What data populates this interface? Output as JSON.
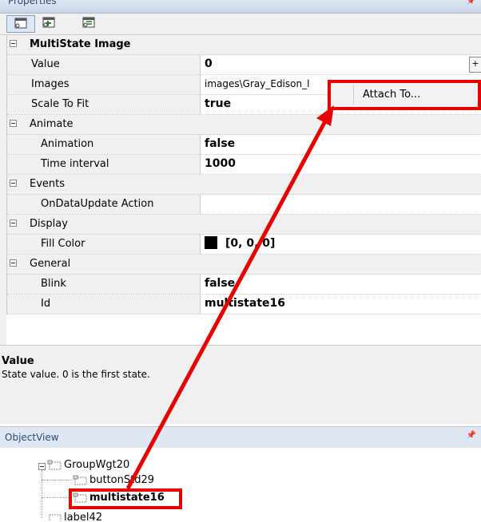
{
  "panel": {
    "title": "Properties"
  },
  "toolbar": {
    "buttons": [
      {
        "icon": "categorized-view-icon"
      },
      {
        "icon": "alphabetical-view-icon"
      },
      {
        "icon": "events-view-icon"
      }
    ]
  },
  "grid": {
    "category_main": "MultiState Image",
    "value_label": "Value",
    "value": "0",
    "value_button": "+",
    "images_label": "Images",
    "images_value": "images\\Gray_Edison_l",
    "scale_label": "Scale To Fit",
    "scale_value": "true",
    "animate_cat": "Animate",
    "animation_label": "Animation",
    "animation_value": "false",
    "interval_label": "Time interval",
    "interval_value": "1000",
    "events_cat": "Events",
    "ondata_label": "OnDataUpdate Action",
    "ondata_value": "",
    "display_cat": "Display",
    "fill_label": "Fill Color",
    "fill_value": "[0, 0, 0]",
    "fill_color": "#000000",
    "general_cat": "General",
    "blink_label": "Blink",
    "blink_value": "false",
    "id_label": "Id",
    "id_value": "multistate16"
  },
  "description": {
    "title": "Value",
    "text": "State value.  0 is the first state."
  },
  "context_menu": {
    "item": "Attach To..."
  },
  "objectview": {
    "title": "ObjectView",
    "nodes": [
      {
        "label": "GroupWgt20"
      },
      {
        "label": "buttonStd29"
      },
      {
        "label": "multistate16"
      },
      {
        "label": "label42"
      }
    ]
  },
  "accent": "#e60000"
}
